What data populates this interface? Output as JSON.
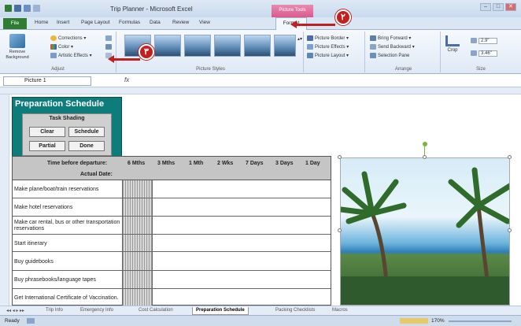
{
  "window": {
    "title": "Trip Planner - Microsoft Excel",
    "context_tab": "Picture Tools",
    "btns": [
      "–",
      "□",
      "✕"
    ]
  },
  "tabs": [
    "File",
    "Home",
    "Insert",
    "Page Layout",
    "Formulas",
    "Data",
    "Review",
    "View",
    "Format"
  ],
  "ribbon": {
    "adjust": {
      "remove_bg": "Remove Background",
      "corrections": "Corrections",
      "color": "Color",
      "artistic": "Artistic Effects",
      "label": "Adjust"
    },
    "styles": {
      "label": "Picture Styles",
      "border": "Picture Border",
      "effects": "Picture Effects",
      "layout": "Picture Layout"
    },
    "arrange": {
      "label": "Arrange",
      "bring": "Bring Forward",
      "send": "Send Backward",
      "pane": "Selection Pane"
    },
    "size": {
      "label": "Size",
      "crop": "Crop",
      "height": "2.9\"",
      "width": "3.46\""
    }
  },
  "formula": {
    "name": "Picture 1",
    "fx": "fx"
  },
  "prep": {
    "title": "Preparation Schedule",
    "shading_title": "Task Shading",
    "buttons": {
      "clear": "Clear",
      "schedule": "Schedule",
      "partial": "Partial",
      "done": "Done"
    }
  },
  "table": {
    "time_label": "Time before departure:",
    "actual_label": "Actual Date:",
    "cols": [
      "6 Mths",
      "3 Mths",
      "1 Mth",
      "2 Wks",
      "7 Days",
      "3 Days",
      "1 Day"
    ],
    "tasks": [
      "Make plane/boat/train reservations",
      "Make hotel reservations",
      "Make car rental, bus or other transportation reservations",
      "Start itinerary",
      "Buy guidebooks",
      "Buy phrasebooks/language tapes",
      "Get International Certificate of Vaccination."
    ]
  },
  "sheets": [
    "Trip Info",
    "Emergency Info",
    "Cost Calculation",
    "Preparation Schedule",
    "Packing Checklists",
    "Macros"
  ],
  "status": {
    "ready": "Ready",
    "zoom": "170%"
  },
  "callouts": {
    "c2": "٢",
    "c3": "٣"
  },
  "colors": {
    "accent": "#c21f1f",
    "file_tab": "#2f7d32",
    "prep_header": "#0e7c7b"
  }
}
